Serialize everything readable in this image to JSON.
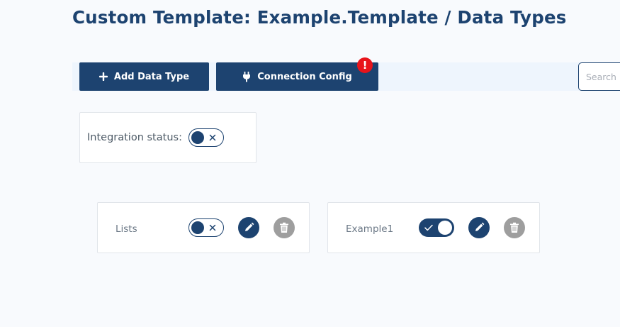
{
  "header": {
    "title": "Custom Template: Example.Template / Data Types"
  },
  "toolbar": {
    "add_label": "Add Data Type",
    "connection_label": "Connection Config",
    "connection_alert": "!",
    "search_placeholder": "Search"
  },
  "integration": {
    "label": "Integration status:",
    "enabled": false
  },
  "data_types": [
    {
      "name": "Lists",
      "enabled": false
    },
    {
      "name": "Example1",
      "enabled": true
    }
  ],
  "colors": {
    "primary": "#1d4370",
    "alert": "#e8141b",
    "delete": "#9e9e9e",
    "toolbar_bg": "#eef5fd"
  },
  "icons": [
    "plus-icon",
    "plug-icon",
    "alert-icon",
    "x-icon",
    "check-icon",
    "pencil-icon",
    "trash-icon"
  ]
}
